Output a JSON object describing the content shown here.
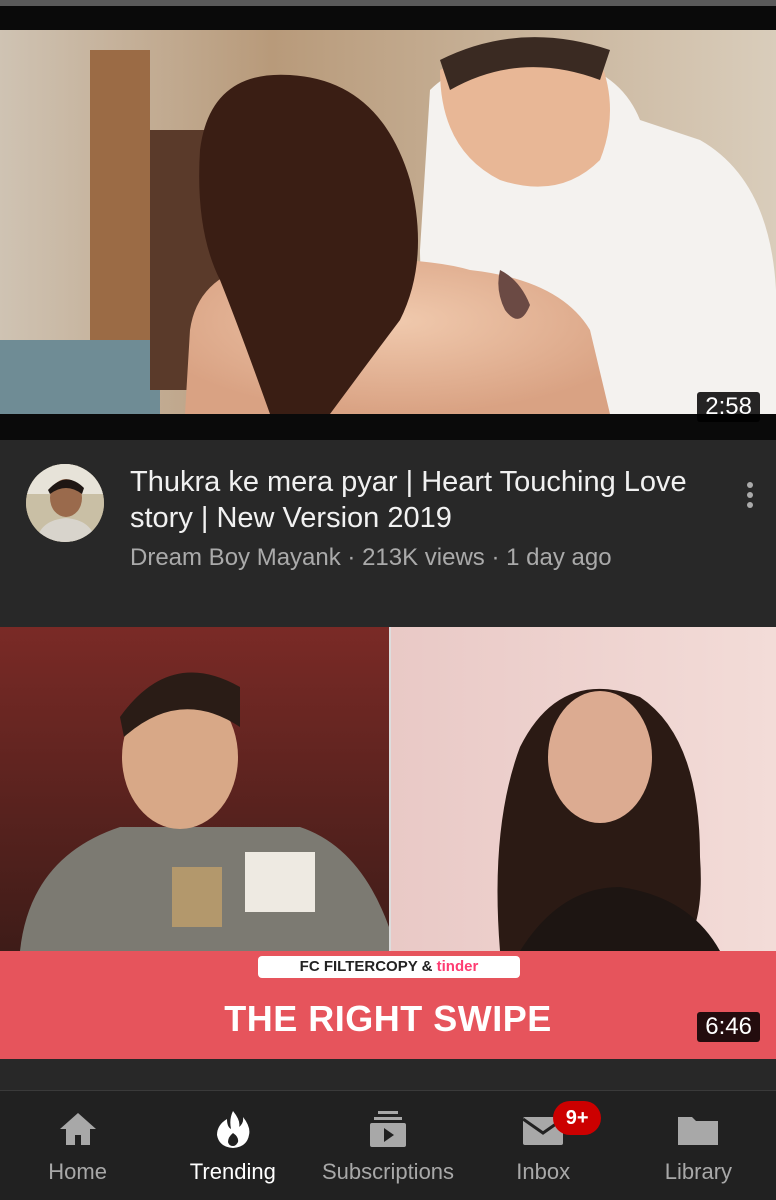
{
  "videos": [
    {
      "duration": "2:58",
      "title": "Thukra ke mera pyar | Heart Touching Love story | New Version 2019",
      "channel": "Dream Boy Mayank",
      "views": "213K views",
      "age": "1 day ago",
      "separator": " · "
    },
    {
      "duration": "6:46",
      "banner_brand": "FC",
      "banner_text": "FILTERCOPY & ",
      "banner_partner": "tinder",
      "banner_title": "THE RIGHT SWIPE"
    }
  ],
  "nav": {
    "items": [
      {
        "label": "Home",
        "icon": "home-icon"
      },
      {
        "label": "Trending",
        "icon": "trending-flame-icon",
        "active": true
      },
      {
        "label": "Subscriptions",
        "icon": "subscriptions-icon"
      },
      {
        "label": "Inbox",
        "icon": "inbox-mail-icon",
        "badge": "9+"
      },
      {
        "label": "Library",
        "icon": "library-folder-icon"
      }
    ]
  },
  "colors": {
    "background": "#282828",
    "nav_background": "#212121",
    "badge": "#cc0000",
    "banner": "#e6545c",
    "tinder": "#fe3c72"
  }
}
